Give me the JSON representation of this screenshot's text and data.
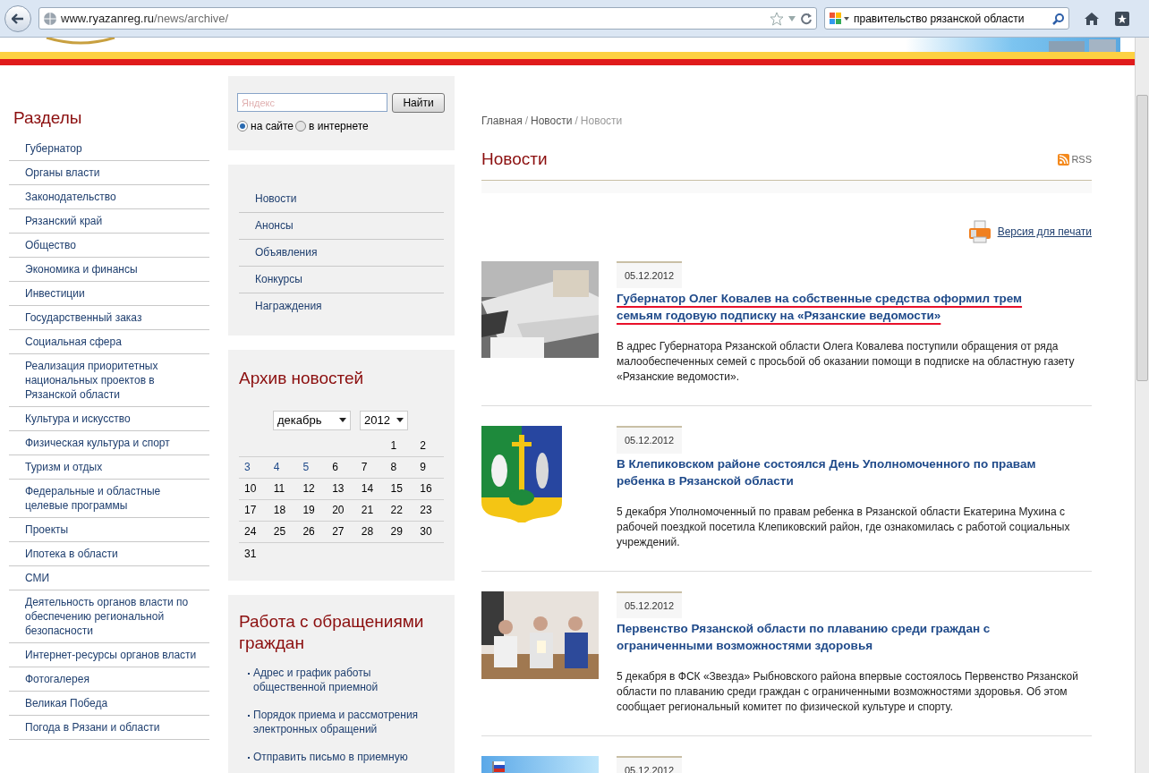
{
  "browser": {
    "url_host": "www.ryazanreg.ru",
    "url_path": "/news/archive/",
    "search_value": "правительство рязанской области"
  },
  "sections": {
    "title": "Разделы",
    "items": [
      {
        "label": "Губернатор"
      },
      {
        "label": "Органы власти"
      },
      {
        "label": "Законодательство"
      },
      {
        "label": "Рязанский край"
      },
      {
        "label": "Общество"
      },
      {
        "label": "Экономика и финансы"
      },
      {
        "label": "Инвестиции"
      },
      {
        "label": "Государственный заказ"
      },
      {
        "label": "Социальная сфера"
      },
      {
        "label": "Реализация приоритетных национальных проектов в Рязанской области"
      },
      {
        "label": "Культура и искусство"
      },
      {
        "label": "Физическая культура и спорт"
      },
      {
        "label": "Туризм и отдых"
      },
      {
        "label": "Федеральные и областные целевые программы"
      },
      {
        "label": "Проекты"
      },
      {
        "label": "Ипотека в области"
      },
      {
        "label": "СМИ"
      },
      {
        "label": "Деятельность органов власти по обеспечению региональной безопасности"
      },
      {
        "label": "Интернет-ресурсы органов власти"
      },
      {
        "label": "Фотогалерея"
      },
      {
        "label": "Великая Победа"
      },
      {
        "label": "Погода в Рязани и области"
      }
    ]
  },
  "site_search": {
    "placeholder": "Яндекс",
    "button": "Найти",
    "scopes": [
      {
        "label": "на сайте",
        "selected": true
      },
      {
        "label": "в интернете",
        "selected": false
      }
    ]
  },
  "news_menu": [
    "Новости",
    "Анонсы",
    "Объявления",
    "Конкурсы",
    "Награждения"
  ],
  "archive": {
    "title": "Архив новостей",
    "month": "декабрь",
    "year": "2012",
    "weeks": [
      [
        {
          "day": "1",
          "linked": false
        },
        {
          "day": "2",
          "linked": false
        }
      ],
      [
        {
          "day": "3",
          "linked": true
        },
        {
          "day": "4",
          "linked": true
        },
        {
          "day": "5",
          "linked": true
        },
        {
          "day": "6",
          "linked": false
        },
        {
          "day": "7",
          "linked": false
        },
        {
          "day": "8",
          "linked": false
        },
        {
          "day": "9",
          "linked": false
        }
      ],
      [
        {
          "day": "10",
          "linked": false
        },
        {
          "day": "11",
          "linked": false
        },
        {
          "day": "12",
          "linked": false
        },
        {
          "day": "13",
          "linked": false
        },
        {
          "day": "14",
          "linked": false
        },
        {
          "day": "15",
          "linked": false
        },
        {
          "day": "16",
          "linked": false
        }
      ],
      [
        {
          "day": "17",
          "linked": false
        },
        {
          "day": "18",
          "linked": false
        },
        {
          "day": "19",
          "linked": false
        },
        {
          "day": "20",
          "linked": false
        },
        {
          "day": "21",
          "linked": false
        },
        {
          "day": "22",
          "linked": false
        },
        {
          "day": "23",
          "linked": false
        }
      ],
      [
        {
          "day": "24",
          "linked": false
        },
        {
          "day": "25",
          "linked": false
        },
        {
          "day": "26",
          "linked": false
        },
        {
          "day": "27",
          "linked": false
        },
        {
          "day": "28",
          "linked": false
        },
        {
          "day": "29",
          "linked": false
        },
        {
          "day": "30",
          "linked": false
        }
      ],
      [
        {
          "day": "31",
          "linked": false
        }
      ]
    ]
  },
  "appeals": {
    "title": "Работа с обращениями граждан",
    "links": [
      "Адрес и график работы общественной приемной",
      "Порядок приема и рассмотрения электронных обращений",
      "Отправить письмо в приемную"
    ]
  },
  "breadcrumbs": [
    {
      "kind": "link",
      "label": "Главная",
      "current": false
    },
    {
      "kind": "separator",
      "label": "/"
    },
    {
      "kind": "link",
      "label": "Новости",
      "current": false
    },
    {
      "kind": "separator",
      "label": "/"
    },
    {
      "kind": "link",
      "label": "Новости",
      "current": true
    }
  ],
  "page_title": "Новости",
  "rss": "RSS",
  "print_link": "Версия для печати",
  "news": [
    {
      "kind": "newspapers",
      "date": "05.12.2012",
      "title": "Губернатор Олег Ковалев на собственные средства оформил трем семьям годовую подписку на «Рязанские ведомости»",
      "marked": true,
      "summary": "В адрес Губернатора Рязанской области Олега Ковалева поступили обращения от ряда малообеспеченных семей с просьбой об оказании помощи в подписке на областную газету «Рязанские ведомости»."
    },
    {
      "kind": "emblem",
      "date": "05.12.2012",
      "title": "В Клепиковском районе состоялся День Уполномоченного по правам ребенка в Рязанской области",
      "marked": false,
      "summary": "5 декабря Уполномоченный по правам ребенка в Рязанской области Екатерина Мухина с рабочей поездкой посетила Клепиковский район, где ознакомилась с работой социальных учреждений."
    },
    {
      "kind": "people",
      "date": "05.12.2012",
      "title": "Первенство Рязанской области по плаванию среди граждан с ограниченными возможностями здоровья",
      "marked": false,
      "summary": "5 декабря в ФСК «Звезда» Рыбновского района впервые состоялось Первенство Рязанской области по плаванию среди граждан с ограниченными возможностями здоровья. Об этом сообщает региональный комитет по физической культуре и спорту."
    },
    {
      "kind": "sky",
      "date": "05.12.2012"
    }
  ]
}
